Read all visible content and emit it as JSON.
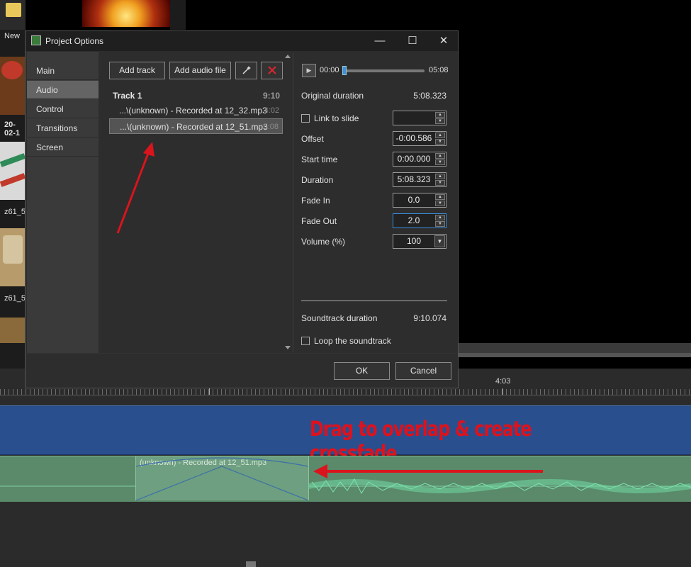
{
  "background": {
    "new_label": "New",
    "thumb_labels": [
      "20-02-1",
      "z61_5",
      "z61_5"
    ],
    "ruler_time": "4:03",
    "audio_clip_label": "(unknown) - Recorded at 12_51.mp3",
    "annotation": "Drag to overlap & create crossfade"
  },
  "dialog": {
    "title": "Project Options",
    "window_controls": {
      "minimize": "—",
      "maximize": "☐",
      "close": "✕"
    },
    "nav": [
      "Main",
      "Audio",
      "Control",
      "Transitions",
      "Screen"
    ],
    "nav_active": "Audio",
    "buttons": {
      "add_track": "Add track",
      "add_audio_file": "Add audio file",
      "wand": "wand-icon",
      "delete": "delete-icon"
    },
    "track": {
      "name": "Track 1",
      "duration": "9:10"
    },
    "files": [
      {
        "name": "...\\(unknown) - Recorded at 12_32.mp3",
        "duration": "4:02"
      },
      {
        "name": "...\\(unknown) - Recorded at 12_51.mp3",
        "duration": "5:08"
      }
    ],
    "player": {
      "start": "00:00",
      "end": "05:08",
      "position_fraction": 0.0
    },
    "original_duration": {
      "label": "Original duration",
      "value": "5:08.323"
    },
    "link_to_slide": {
      "label": "Link to slide",
      "checked": false,
      "value": ""
    },
    "fields": [
      {
        "label": "Offset",
        "value": "-0:00.586"
      },
      {
        "label": "Start time",
        "value": "0:00.000"
      },
      {
        "label": "Duration",
        "value": "5:08.323"
      },
      {
        "label": "Fade In",
        "value": "0.0"
      },
      {
        "label": "Fade Out",
        "value": "2.0"
      }
    ],
    "volume": {
      "label": "Volume (%)",
      "value": "100"
    },
    "soundtrack_duration": {
      "label": "Soundtrack duration",
      "value": "9:10.074"
    },
    "loop": {
      "label": "Loop the soundtrack",
      "checked": false
    },
    "ok": "OK",
    "cancel": "Cancel"
  },
  "colors": {
    "accent": "#3d8fe0",
    "annotation": "#e0111b",
    "video_track": "#2a4f8f",
    "audio_track": "#5a8a6a"
  }
}
